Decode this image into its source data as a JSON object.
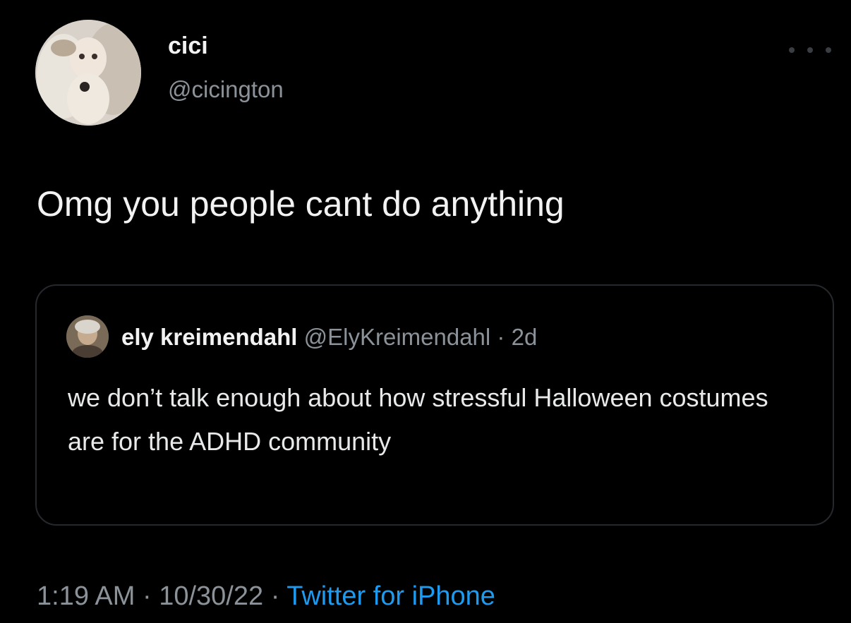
{
  "author": {
    "display_name": "cici",
    "handle": "@cicington",
    "avatar_icon": "profile-avatar-icon"
  },
  "tweet": {
    "text": "Omg you people cant do anything"
  },
  "quoted_tweet": {
    "display_name": "ely kreimendahl",
    "handle": "@ElyKreimendahl",
    "separator": "·",
    "time": "2d",
    "text": "we don’t talk enough about how stressful Halloween costumes are for the ADHD community",
    "avatar_icon": "quoted-avatar-icon"
  },
  "footer": {
    "time": "1:19 AM",
    "separator": "·",
    "date": "10/30/22",
    "separator2": "·",
    "source": "Twitter for iPhone"
  },
  "colors": {
    "background": "#000000",
    "primary_text": "#f2f2f2",
    "secondary_text": "#8b9299",
    "link": "#1d9bf0",
    "border": "#25282c"
  },
  "icons": {
    "more": "more-options-icon"
  }
}
